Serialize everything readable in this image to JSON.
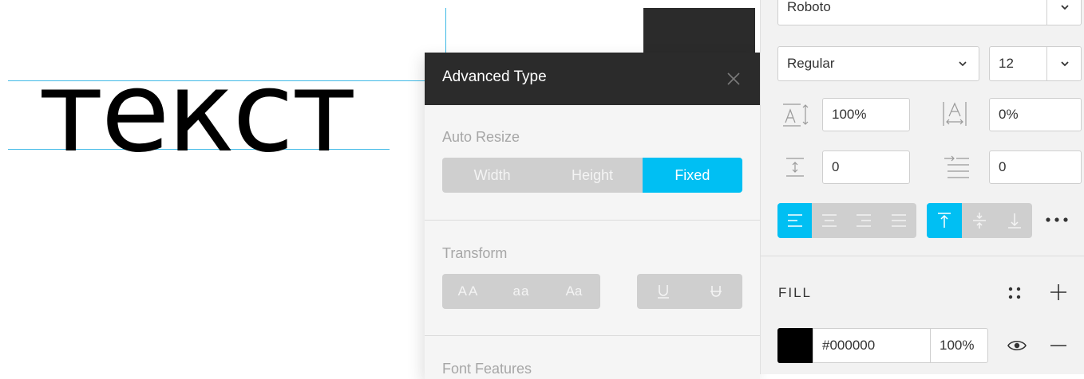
{
  "canvas": {
    "sample_text": "текст"
  },
  "popup": {
    "title": "Advanced Type",
    "auto_resize": {
      "label": "Auto Resize",
      "options": [
        "Width",
        "Height",
        "Fixed"
      ],
      "selected": "Fixed"
    },
    "transform": {
      "label": "Transform",
      "case_options": [
        "AA",
        "aa",
        "Aa"
      ],
      "decoration_options": [
        "underline",
        "strikethrough"
      ]
    },
    "font_features": {
      "label": "Font Features"
    }
  },
  "panel": {
    "font_family": "Roboto",
    "font_weight": "Regular",
    "font_size": "12",
    "line_height": "100%",
    "letter_spacing": "0%",
    "paragraph_spacing": "0",
    "paragraph_indent": "0",
    "text_align": "left",
    "vertical_align": "top",
    "fill": {
      "label": "FILL",
      "color_hex": "#000000",
      "opacity": "100%",
      "visible": true
    }
  },
  "colors": {
    "accent": "#00bff3",
    "dark": "#2b2b2b",
    "guide": "#3fb9e6"
  }
}
